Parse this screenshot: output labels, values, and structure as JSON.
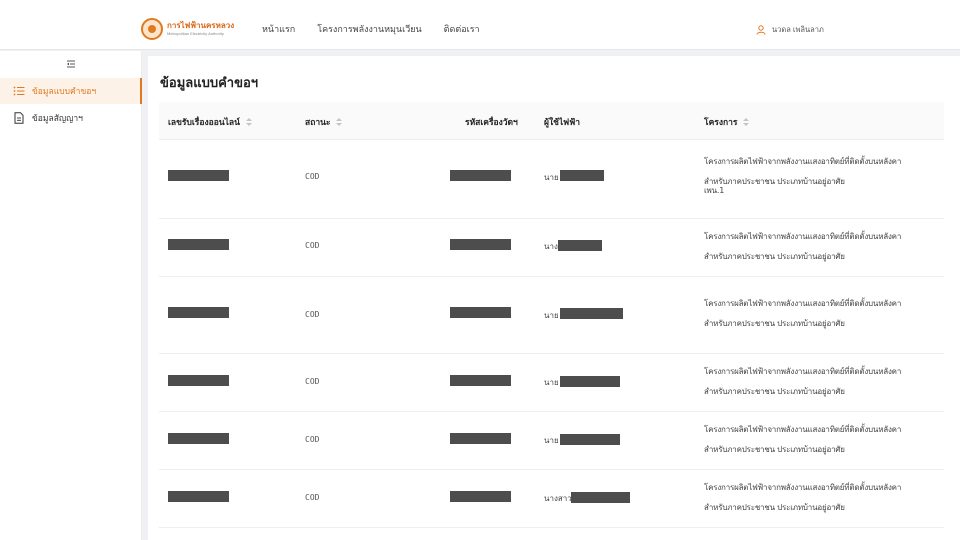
{
  "header": {
    "logo": {
      "name_th": "การไฟฟ้านครหลวง",
      "name_en": "Metropolitan Electricity Authority"
    },
    "nav": [
      "หน้าแรก",
      "โครงการพลังงานหมุนเวียน",
      "ติดต่อเรา"
    ],
    "user_name": "นวดล เพลินลาภ",
    "accent": "#e07a1f"
  },
  "sidebar": {
    "toggle_icon": "menu-fold-icon",
    "items": [
      {
        "label": "ข้อมูลแบบคำขอฯ",
        "icon": "list-icon",
        "active": true
      },
      {
        "label": "ข้อมูลสัญญาฯ",
        "icon": "document-icon",
        "active": false
      }
    ]
  },
  "main": {
    "title": "ข้อมูลแบบคำขอฯ",
    "table": {
      "columns": [
        {
          "label": "เลขรับเรื่องออนไลน์",
          "sortable": true
        },
        {
          "label": "สถานะ",
          "sortable": true
        },
        {
          "label": "รหัสเครื่องวัดฯ",
          "sortable": false
        },
        {
          "label": "ผู้ใช้ไฟฟ้า",
          "sortable": false
        },
        {
          "label": "โครงการ",
          "sortable": true
        }
      ],
      "rows": [
        {
          "status": "COD",
          "user_prefix": "นาย",
          "project_lines": [
            "โครงการผลิตไฟฟ้าจากพลังงานแสงอาทิตย์ที่ติดตั้งบนหลังคา",
            "สำหรับภาคประชาชน ประเภทบ้านอยู่อาศัย",
            "เพน.1"
          ]
        },
        {
          "status": "COD",
          "user_prefix": "นาง",
          "project_lines": [
            "โครงการผลิตไฟฟ้าจากพลังงานแสงอาทิตย์ที่ติดตั้งบนหลังคา",
            "สำหรับภาคประชาชน ประเภทบ้านอยู่อาศัย"
          ]
        },
        {
          "status": "COD",
          "user_prefix": "นาย",
          "project_lines": [
            "โครงการผลิตไฟฟ้าจากพลังงานแสงอาทิตย์ที่ติดตั้งบนหลังคา",
            "สำหรับภาคประชาชน ประเภทบ้านอยู่อาศัย"
          ]
        },
        {
          "status": "COD",
          "user_prefix": "นาย",
          "project_lines": [
            "โครงการผลิตไฟฟ้าจากพลังงานแสงอาทิตย์ที่ติดตั้งบนหลังคา",
            "สำหรับภาคประชาชน ประเภทบ้านอยู่อาศัย"
          ]
        },
        {
          "status": "COD",
          "user_prefix": "นาย",
          "project_lines": [
            "โครงการผลิตไฟฟ้าจากพลังงานแสงอาทิตย์ที่ติดตั้งบนหลังคา",
            "สำหรับภาคประชาชน ประเภทบ้านอยู่อาศัย"
          ]
        },
        {
          "status": "COD",
          "user_prefix": "นางสาว",
          "project_lines": [
            "โครงการผลิตไฟฟ้าจากพลังงานแสงอาทิตย์ที่ติดตั้งบนหลังคา",
            "สำหรับภาคประชาชน ประเภทบ้านอยู่อาศัย"
          ]
        }
      ]
    }
  }
}
